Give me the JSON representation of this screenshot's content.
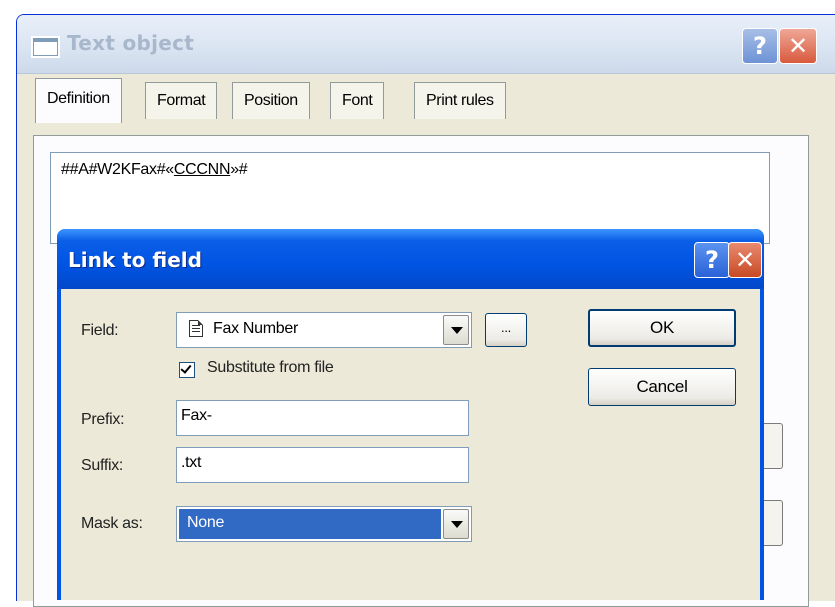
{
  "outer_window": {
    "title": "Text object",
    "tabs": [
      "Definition",
      "Format",
      "Position",
      "Font",
      "Print rules"
    ],
    "expression": {
      "prefix": "##A#W2KFax#«",
      "field": "CCCNN",
      "suffix": "»#"
    }
  },
  "dialog": {
    "title": "Link to field",
    "field_label": "Field:",
    "field_value": "Fax Number",
    "browse_label": "...",
    "substitute_label": "Substitute from file",
    "substitute_checked": true,
    "prefix_label": "Prefix:",
    "prefix_value": "Fax-",
    "suffix_label": "Suffix:",
    "suffix_value": ".txt",
    "mask_label": "Mask as:",
    "mask_value": "None",
    "ok_label": "OK",
    "cancel_label": "Cancel"
  },
  "caption_buttons": {
    "help": "?",
    "close": "✕"
  },
  "colors": {
    "title_blue": "#0054e3",
    "selection": "#316ac5",
    "dialog_face": "#ece9d8"
  }
}
